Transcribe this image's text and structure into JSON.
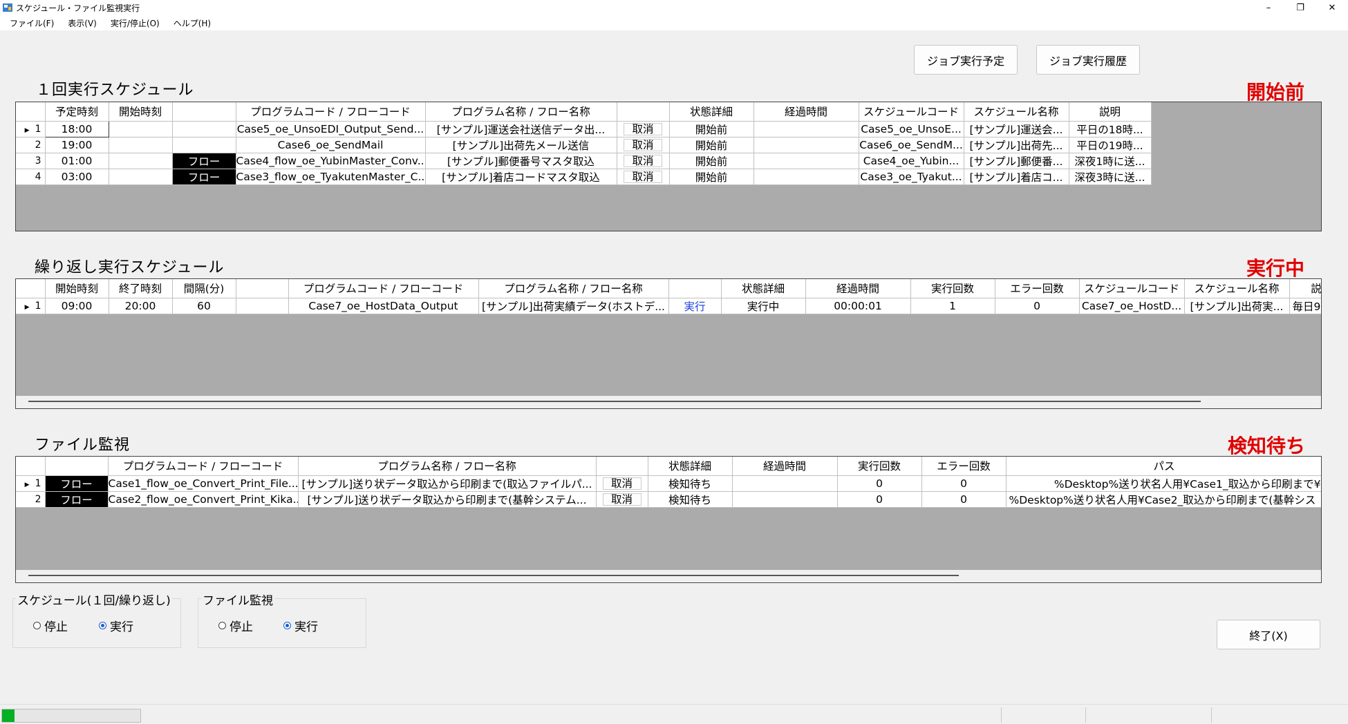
{
  "window": {
    "title": "スケジュール・ファイル監視実行",
    "controls": [
      "–",
      "❐",
      "✕"
    ]
  },
  "menu": [
    {
      "label": "ファイル(F)"
    },
    {
      "label": "表示(V)"
    },
    {
      "label": "実行/停止(O)"
    },
    {
      "label": "ヘルプ(H)"
    }
  ],
  "buttons": {
    "job_schedule": "ジョブ実行予定",
    "job_history": "ジョブ実行履歴",
    "exit": "終了(X)"
  },
  "once": {
    "title": "１回実行スケジュール",
    "status_label": "開始前",
    "columns": [
      "",
      "予定時刻",
      "開始時刻",
      "",
      "プログラムコード / フローコード",
      "プログラム名称 / フロー名称",
      "",
      "状態詳細",
      "経過時間",
      "スケジュールコード",
      "スケジュール名称",
      "説明"
    ],
    "rows": [
      {
        "num": "1",
        "current": true,
        "sched": "18:00",
        "start": "",
        "flow": "",
        "code": "Case5_oe_UnsoEDI_Output_Send...",
        "name": "[サンプル]運送会社送信データ出...",
        "cancel": "取消",
        "status": "開始前",
        "elapsed": "",
        "scode": "Case5_oe_UnsoE...",
        "sname": "[サンプル]運送会...",
        "desc": "平日の18時..."
      },
      {
        "num": "2",
        "current": false,
        "sched": "19:00",
        "start": "",
        "flow": "",
        "code": "Case6_oe_SendMail",
        "name": "[サンプル]出荷先メール送信",
        "cancel": "取消",
        "status": "開始前",
        "elapsed": "",
        "scode": "Case6_oe_SendM...",
        "sname": "[サンプル]出荷先...",
        "desc": "平日の19時..."
      },
      {
        "num": "3",
        "current": false,
        "sched": "01:00",
        "start": "",
        "flow": "フロー",
        "code": "Case4_flow_oe_YubinMaster_Conv...",
        "name": "[サンプル]郵便番号マスタ取込",
        "cancel": "取消",
        "status": "開始前",
        "elapsed": "",
        "scode": "Case4_oe_Yubin...",
        "sname": "[サンプル]郵便番...",
        "desc": "深夜1時に送..."
      },
      {
        "num": "4",
        "current": false,
        "sched": "03:00",
        "start": "",
        "flow": "フロー",
        "code": "Case3_flow_oe_TyakutenMaster_C...",
        "name": "[サンプル]着店コードマスタ取込",
        "cancel": "取消",
        "status": "開始前",
        "elapsed": "",
        "scode": "Case3_oe_Tyakut...",
        "sname": "[サンプル]着店コ...",
        "desc": "深夜3時に送..."
      }
    ]
  },
  "repeat": {
    "title": "繰り返し実行スケジュール",
    "status_label": "実行中",
    "columns": [
      "",
      "開始時刻",
      "終了時刻",
      "間隔(分)",
      "",
      "プログラムコード / フローコード",
      "プログラム名称 / フロー名称",
      "",
      "状態詳細",
      "経過時間",
      "実行回数",
      "エラー回数",
      "スケジュールコード",
      "スケジュール名称",
      "説"
    ],
    "rows": [
      {
        "num": "1",
        "current": true,
        "start": "09:00",
        "end": "20:00",
        "interval": "60",
        "flow": "",
        "code": "Case7_oe_HostData_Output",
        "name": "[サンプル]出荷実績データ(ホストデ...",
        "action": "実行",
        "status": "実行中",
        "elapsed": "00:00:01",
        "runs": "1",
        "errors": "0",
        "scode": "Case7_oe_HostD...",
        "sname": "[サンプル]出荷実...",
        "desc": "毎日9..."
      }
    ]
  },
  "file": {
    "title": "ファイル監視",
    "status_label": "検知待ち",
    "columns": [
      "",
      "",
      "プログラムコード / フローコード",
      "プログラム名称 / フロー名称",
      "",
      "状態詳細",
      "経過時間",
      "実行回数",
      "エラー回数",
      "パス"
    ],
    "rows": [
      {
        "num": "1",
        "current": true,
        "flow": "フロー",
        "code": "Case1_flow_oe_Convert_Print_File...",
        "name": "[サンプル]送り状データ取込から印刷まで(取込ファイルパ...",
        "cancel": "取消",
        "status": "検知待ち",
        "elapsed": "",
        "runs": "0",
        "errors": "0",
        "path": "%Desktop%送り状名人用¥Case1_取込から印刷まで¥"
      },
      {
        "num": "2",
        "current": false,
        "flow": "フロー",
        "code": "Case2_flow_oe_Convert_Print_Kika...",
        "name": "[サンプル]送り状データ取込から印刷まで(基幹システム...",
        "cancel": "取消",
        "status": "検知待ち",
        "elapsed": "",
        "runs": "0",
        "errors": "0",
        "path": "%Desktop%送り状名人用¥Case2_取込から印刷まで(基幹シス"
      }
    ]
  },
  "schedule_group": {
    "label": "スケジュール(１回/繰り返し)",
    "stop": "停止",
    "run": "実行",
    "selected": "run"
  },
  "file_group": {
    "label": "ファイル監視",
    "stop": "停止",
    "run": "実行",
    "selected": "run"
  },
  "progress": {
    "value": 0.09,
    "color": "#06b025"
  }
}
